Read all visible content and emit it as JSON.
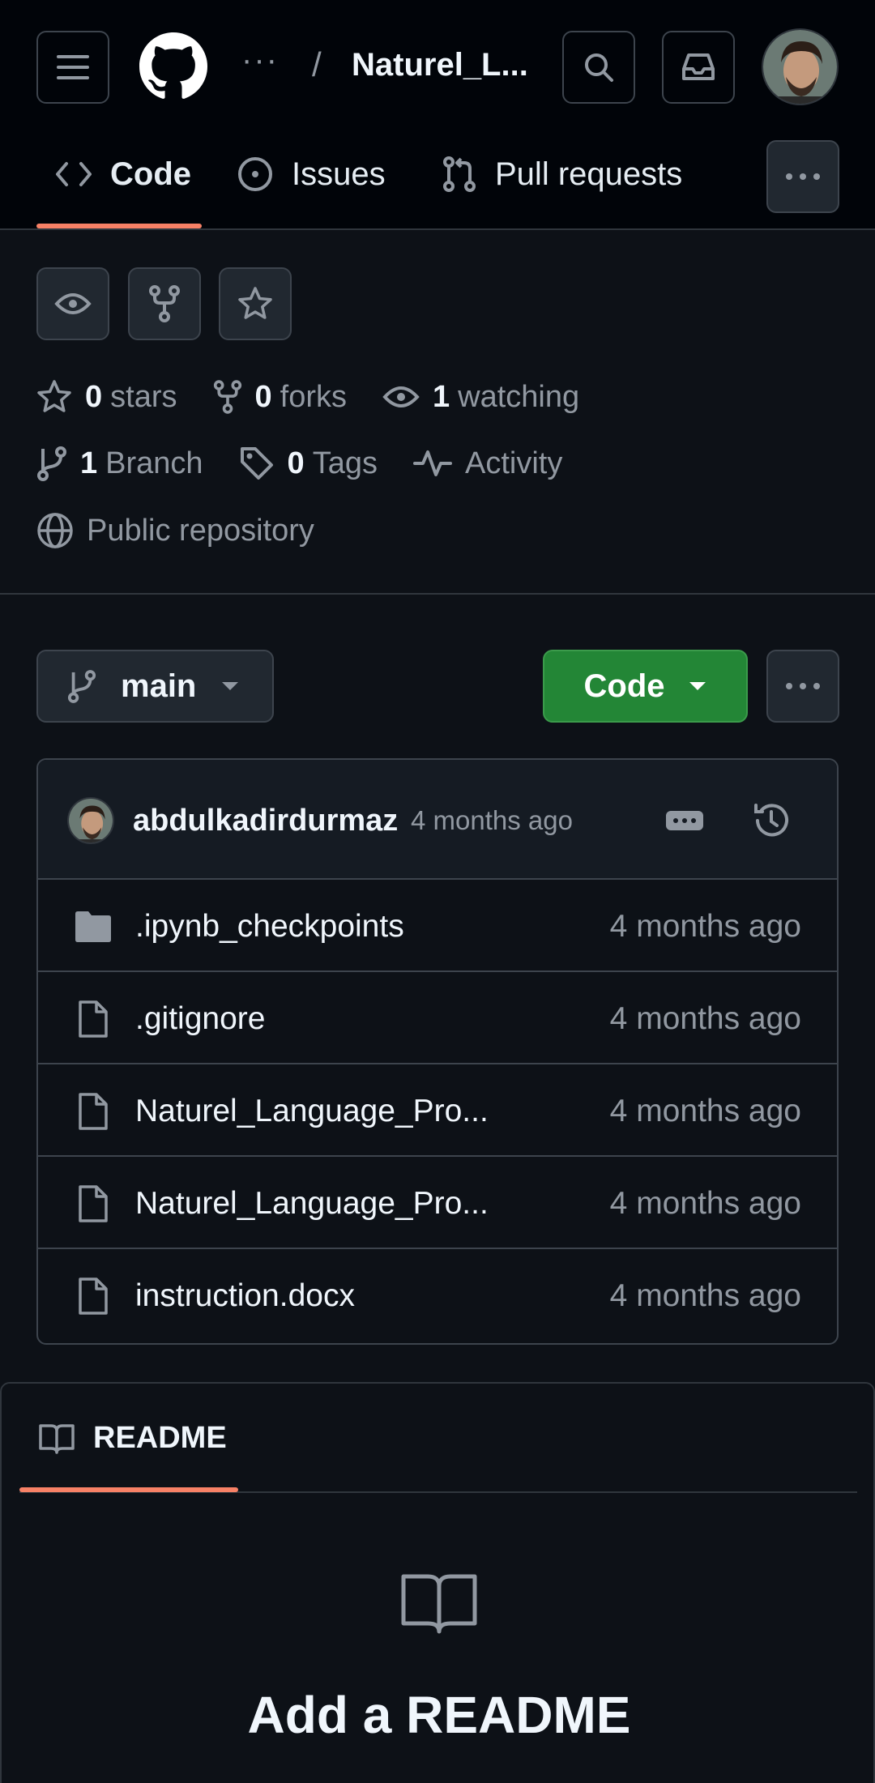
{
  "header": {
    "breadcrumb_ellipsis": "···",
    "separator": "/",
    "repo_name": "Naturel_L..."
  },
  "tabs": [
    {
      "label": "Code",
      "icon": "code-icon",
      "active": true
    },
    {
      "label": "Issues",
      "icon": "issue-icon"
    },
    {
      "label": "Pull requests",
      "icon": "pull-request-icon"
    }
  ],
  "stats": {
    "stars_count": "0",
    "stars_label": "stars",
    "forks_count": "0",
    "forks_label": "forks",
    "watching_count": "1",
    "watching_label": "watching",
    "branch_count": "1",
    "branch_label": "Branch",
    "tags_count": "0",
    "tags_label": "Tags",
    "activity_label": "Activity",
    "visibility_label": "Public repository"
  },
  "toolbar": {
    "branch": "main",
    "code_button": "Code"
  },
  "latest_commit": {
    "user": "abdulkadirdurmaz",
    "time": "4 months ago"
  },
  "files": [
    {
      "name": ".ipynb_checkpoints",
      "type": "folder",
      "time": "4 months ago"
    },
    {
      "name": ".gitignore",
      "type": "file",
      "time": "4 months ago"
    },
    {
      "name": "Naturel_Language_Pro...",
      "type": "file",
      "time": "4 months ago"
    },
    {
      "name": "Naturel_Language_Pro...",
      "type": "file",
      "time": "4 months ago"
    },
    {
      "name": "instruction.docx",
      "type": "file",
      "time": "4 months ago"
    }
  ],
  "readme": {
    "tab_label": "README",
    "title": "Add a README"
  },
  "colors": {
    "accent_underline": "#f78166",
    "code_button_green": "#238636",
    "background": "#0d1117"
  }
}
